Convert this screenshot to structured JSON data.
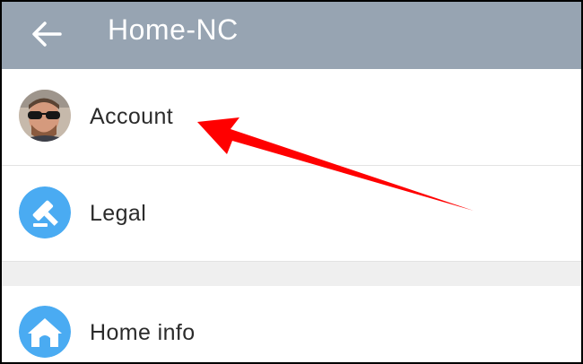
{
  "app_bar": {
    "title": "Home-NC",
    "back_icon": "arrow-left-icon",
    "background": "#97a4b2"
  },
  "menu": {
    "items": [
      {
        "label": "Account",
        "icon": "user-avatar"
      },
      {
        "label": "Legal",
        "icon": "gavel-icon"
      },
      {
        "label": "Home info",
        "icon": "home-icon"
      }
    ]
  },
  "annotation": {
    "type": "red-arrow",
    "points_to": "Account",
    "color": "#ff0000"
  },
  "colors": {
    "icon_circle": "#4aabf2",
    "divider": "#e3e3e3",
    "section_gap": "#efefef"
  }
}
